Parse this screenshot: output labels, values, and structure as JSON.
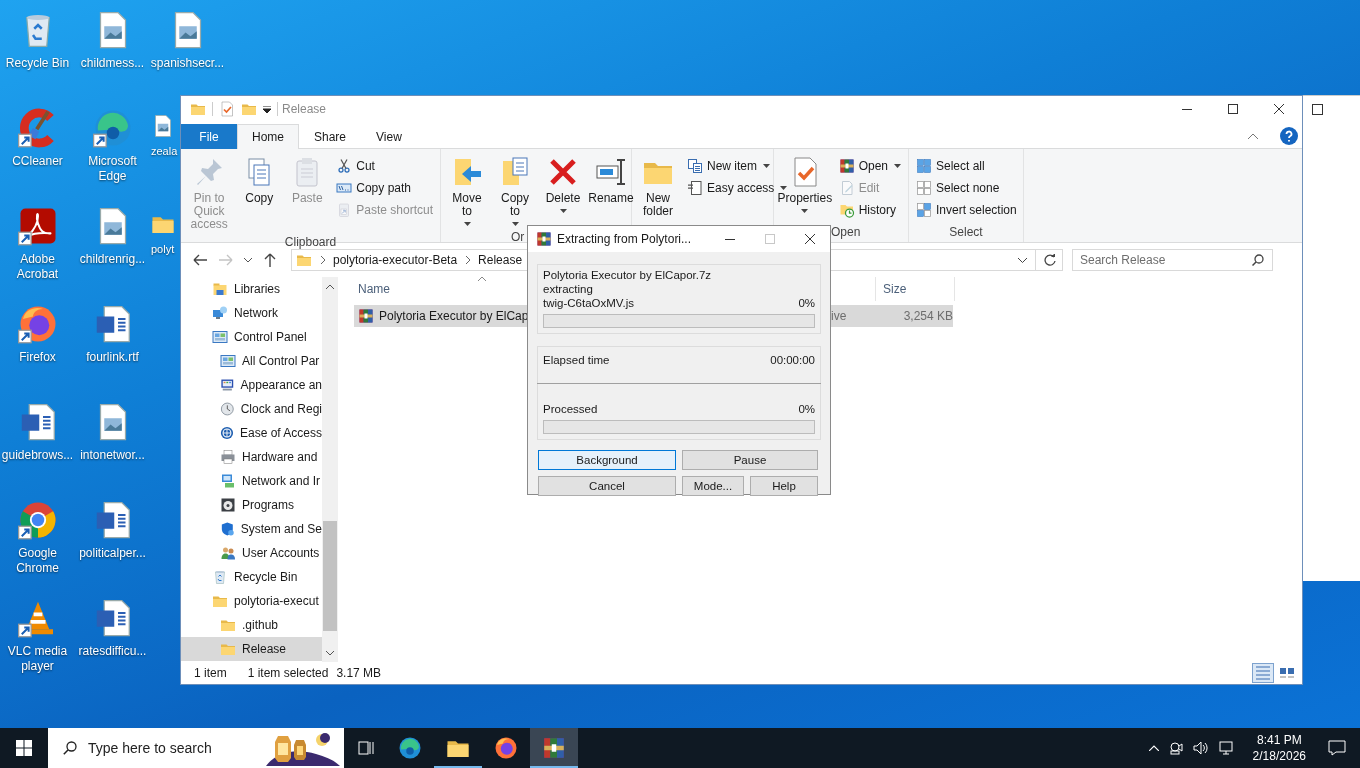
{
  "desktop": {
    "icons": [
      {
        "label": "Recycle Bin",
        "shortcut": false
      },
      {
        "label": "CCleaner",
        "shortcut": true
      },
      {
        "label": "Adobe Acrobat",
        "shortcut": true
      },
      {
        "label": "Firefox",
        "shortcut": true
      },
      {
        "label": "guidebrows...",
        "shortcut": false
      },
      {
        "label": "Google Chrome",
        "shortcut": true
      },
      {
        "label": "VLC media player",
        "shortcut": true
      },
      {
        "label": "childmess...",
        "shortcut": false
      },
      {
        "label": "Microsoft Edge",
        "shortcut": true
      },
      {
        "label": "childrenrig...",
        "shortcut": false
      },
      {
        "label": "fourlink.rtf",
        "shortcut": false
      },
      {
        "label": "intonetwor...",
        "shortcut": false
      },
      {
        "label": "politicalper...",
        "shortcut": false
      },
      {
        "label": "ratesdifficu...",
        "shortcut": false
      },
      {
        "label": "spanishsecr...",
        "shortcut": false
      },
      {
        "label": "zeala",
        "shortcut": false
      },
      {
        "label": "polyt",
        "shortcut": false
      }
    ]
  },
  "explorer": {
    "title": "Release",
    "tabs": [
      {
        "label": "File",
        "kind": "file",
        "selected": false
      },
      {
        "label": "Home",
        "kind": "tab",
        "selected": true
      },
      {
        "label": "Share",
        "kind": "tab",
        "selected": false
      },
      {
        "label": "View",
        "kind": "tab",
        "selected": false
      }
    ],
    "ribbon": {
      "groups": [
        {
          "label": "Clipboard",
          "items": [
            {
              "kind": "large",
              "label": "Pin to Quick access",
              "disabled": true,
              "menu": false
            },
            {
              "kind": "large",
              "label": "Copy",
              "disabled": false,
              "menu": false
            },
            {
              "kind": "large",
              "label": "Paste",
              "disabled": true,
              "menu": false
            },
            {
              "kind": "small",
              "label": "Cut",
              "disabled": false,
              "menu": false
            },
            {
              "kind": "small",
              "label": "Copy path",
              "disabled": false,
              "menu": false
            },
            {
              "kind": "small",
              "label": "Paste shortcut",
              "disabled": true,
              "menu": false
            }
          ]
        },
        {
          "label": "Or",
          "items": [
            {
              "kind": "large",
              "label": "Move to",
              "disabled": false,
              "menu": true
            },
            {
              "kind": "large",
              "label": "Copy to",
              "disabled": false,
              "menu": true
            },
            {
              "kind": "large",
              "label": "Delete",
              "disabled": false,
              "menu": true
            },
            {
              "kind": "large",
              "label": "Rename",
              "disabled": false,
              "menu": false
            }
          ]
        },
        {
          "items": [
            {
              "kind": "large",
              "label": "New folder",
              "disabled": false,
              "menu": false
            },
            {
              "kind": "small",
              "label": "New item",
              "disabled": false,
              "menu": true
            },
            {
              "kind": "small",
              "label": "Easy access",
              "disabled": false,
              "menu": true
            }
          ]
        },
        {
          "label": "Open",
          "items": [
            {
              "kind": "large",
              "label": "Properties",
              "disabled": false,
              "menu": true
            },
            {
              "kind": "small",
              "label": "Open",
              "disabled": false,
              "menu": true
            },
            {
              "kind": "small",
              "label": "Edit",
              "disabled": true,
              "menu": false
            },
            {
              "kind": "small",
              "label": "History",
              "disabled": false,
              "menu": false
            }
          ]
        },
        {
          "label": "Select",
          "items": [
            {
              "kind": "small",
              "label": "Select all",
              "disabled": false,
              "menu": false
            },
            {
              "kind": "small",
              "label": "Select none",
              "disabled": false,
              "menu": false
            },
            {
              "kind": "small",
              "label": "Invert selection",
              "disabled": false,
              "menu": false
            }
          ]
        }
      ]
    },
    "address": {
      "crumbs": [
        "polytoria-executor-Beta",
        "Release"
      ]
    },
    "search": {
      "placeholder": "Search Release"
    },
    "nav": {
      "items": [
        {
          "label": "Libraries",
          "selected": false
        },
        {
          "label": "Network",
          "selected": false
        },
        {
          "label": "Control Panel",
          "selected": false,
          "children": [
            {
              "label": "All Control Par",
              "selected": false
            },
            {
              "label": "Appearance an",
              "selected": false
            },
            {
              "label": "Clock and Regi",
              "selected": false
            },
            {
              "label": "Ease of Access",
              "selected": false
            },
            {
              "label": "Hardware and",
              "selected": false
            },
            {
              "label": "Network and Ir",
              "selected": false
            },
            {
              "label": "Programs",
              "selected": false
            },
            {
              "label": "System and Se",
              "selected": false
            },
            {
              "label": "User Accounts",
              "selected": false
            }
          ]
        },
        {
          "label": "Recycle Bin",
          "selected": false
        },
        {
          "label": "polytoria-execut",
          "selected": false,
          "children": [
            {
              "label": ".github",
              "selected": false
            },
            {
              "label": "Release",
              "selected": true
            }
          ]
        }
      ]
    },
    "columns": [
      {
        "label": "Name",
        "sorted": true
      },
      {
        "label": "Size",
        "sorted": false
      }
    ],
    "rows": [
      {
        "name": "Polytoria Executor by ElCap",
        "type": "ive",
        "size": "3,254 KB",
        "selected": true
      }
    ],
    "status": {
      "count": "1 item",
      "selection": "1 item selected",
      "size": "3.17 MB",
      "views": [
        {
          "selected": true
        },
        {
          "selected": false
        }
      ]
    }
  },
  "dialog": {
    "title": "Extracting from Polytori...",
    "archive": "Polytoria Executor by ElCapor.7z",
    "action": "extracting",
    "file": "twig-C6taOxMV.js",
    "file_percent": "0%",
    "file_progress": {
      "level": 0
    },
    "elapsed_label": "Elapsed time",
    "elapsed": "00:00:00",
    "processed_label": "Processed",
    "processed_percent": "0%",
    "processed_progress": {
      "level": 0
    },
    "buttons": [
      {
        "label": "Background",
        "default": true
      },
      {
        "label": "Pause",
        "default": false
      },
      {
        "label": "Cancel",
        "default": false
      },
      {
        "label": "Mode...",
        "default": false
      },
      {
        "label": "Help",
        "default": false
      }
    ]
  },
  "taskbar": {
    "search": {
      "placeholder": "Type here to search"
    },
    "apps": [
      {
        "running": false,
        "selected": false
      },
      {
        "running": true,
        "selected": false
      },
      {
        "running": false,
        "selected": false
      },
      {
        "running": true,
        "selected": true
      }
    ],
    "clock": {
      "time": "8:41 PM",
      "date": "2/18/2026"
    }
  }
}
